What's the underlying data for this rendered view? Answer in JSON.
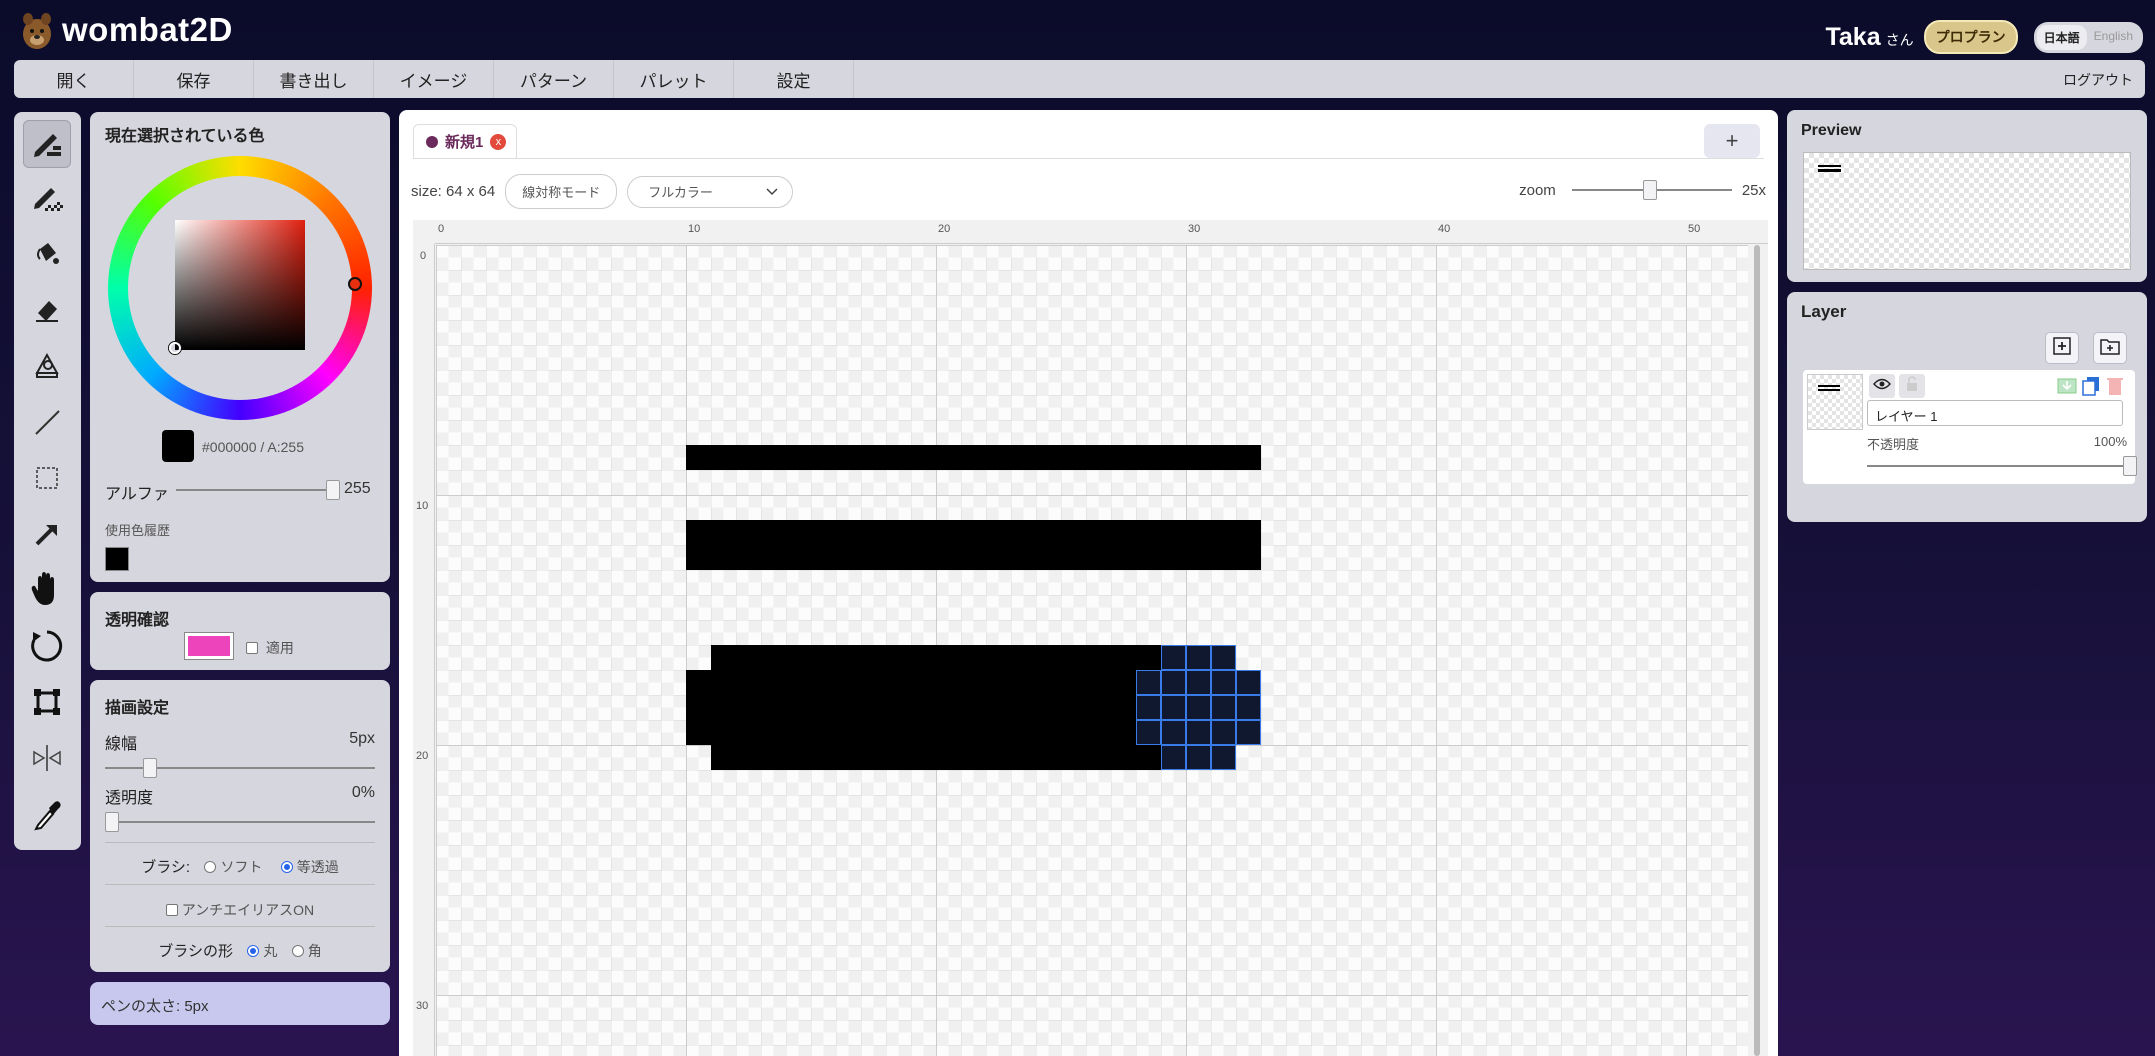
{
  "app": {
    "name": "wombat2D"
  },
  "user": {
    "name": "Taka",
    "suffix": "さん",
    "plan": "プロプラン"
  },
  "language": {
    "options": [
      "日本語",
      "English"
    ],
    "active": "日本語"
  },
  "menu": {
    "items": [
      "開く",
      "保存",
      "書き出し",
      "イメージ",
      "パターン",
      "パレット",
      "設定"
    ],
    "logout": "ログアウト"
  },
  "tools": [
    {
      "icon": "pen-icon",
      "active": true
    },
    {
      "icon": "dither-pen-icon"
    },
    {
      "icon": "fill-bucket-icon"
    },
    {
      "icon": "eraser-icon"
    },
    {
      "icon": "lasso-fill-icon"
    },
    {
      "icon": "line-icon"
    },
    {
      "icon": "rect-select-icon"
    },
    {
      "icon": "arrow-icon"
    },
    {
      "icon": "hand-icon"
    },
    {
      "icon": "rotate-icon"
    },
    {
      "icon": "transform-icon"
    },
    {
      "icon": "mirror-icon"
    },
    {
      "icon": "eyedropper-icon"
    }
  ],
  "color_panel": {
    "title": "現在選択されている色",
    "hex": "#000000 / A:255",
    "current_color": "#000000",
    "alpha_label": "アルファ",
    "alpha_value": "255",
    "alpha_fraction": 1.0,
    "history_label": "使用色履歴",
    "history": [
      "#000000"
    ]
  },
  "transparency": {
    "title": "透明確認",
    "swatch": "#ee44bb",
    "apply_label": "適用"
  },
  "draw_settings": {
    "title": "描画設定",
    "line_width_label": "線幅",
    "line_width_value": "5px",
    "line_width_fraction": 0.14,
    "opacity_label": "透明度",
    "opacity_value": "0%",
    "opacity_fraction": 0.0,
    "brush_label": "ブラシ:",
    "brush_soft": "ソフト",
    "brush_even": "等透過",
    "antialias_label": "アンチエイリアスON",
    "shape_label": "ブラシの形",
    "shape_round": "丸",
    "shape_square": "角"
  },
  "status": {
    "text": "ペンの太さ: 5px"
  },
  "document": {
    "tab_label": "新規1",
    "tab_close": "x",
    "add_tab": "+",
    "size_text": "size: 64 x 64",
    "symmetry_button": "線対称モード",
    "color_mode": "フルカラー",
    "zoom_label": "zoom",
    "zoom_value": "25x",
    "zoom_fraction": 0.49
  },
  "ruler": {
    "x_labels": [
      "0",
      "10",
      "20",
      "30",
      "40",
      "50"
    ],
    "y_labels": [
      "0",
      "10",
      "20",
      "30"
    ]
  },
  "pixels": [
    {
      "x": 10,
      "y": 8,
      "w": 23,
      "h": 1
    },
    {
      "x": 10,
      "y": 11,
      "w": 23,
      "h": 2
    },
    {
      "x": 11,
      "y": 16,
      "w": 18,
      "h": 5
    },
    {
      "x": 10,
      "y": 17,
      "w": 1,
      "h": 3
    }
  ],
  "cursor_preview": {
    "x": 28,
    "y": 16,
    "w": 5,
    "h": 5
  },
  "preview": {
    "title": "Preview"
  },
  "layers": {
    "title": "Layer",
    "items": [
      {
        "name": "レイヤー 1",
        "opacity_label": "不透明度",
        "opacity_value": "100%",
        "opacity_fraction": 1.0
      }
    ]
  }
}
